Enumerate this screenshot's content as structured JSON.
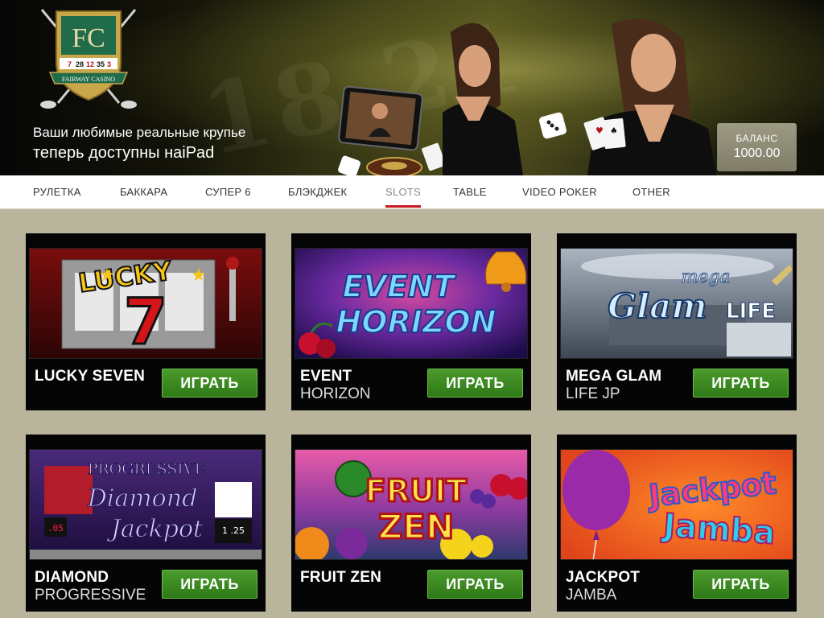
{
  "header": {
    "tagline_line1": "Ваши любимые реальные крупье",
    "tagline_line2": "теперь доступны наiPad",
    "logo_numbers": [
      "7",
      "28",
      "12",
      "35",
      "3"
    ],
    "logo_text": "FAIRWAY CASINO",
    "logo_monogram": "FC"
  },
  "balance": {
    "label": "БАЛАНС",
    "value": "1000.00"
  },
  "nav": {
    "items": [
      {
        "label": "РУЛЕТКА",
        "active": false
      },
      {
        "label": "БАККАРА",
        "active": false
      },
      {
        "label": "СУПЕР 6",
        "active": false
      },
      {
        "label": "БЛЭКДЖЕК",
        "active": false
      },
      {
        "label": "SLOTS",
        "active": true
      },
      {
        "label": "TABLE",
        "active": false
      },
      {
        "label": "VIDEO POKER",
        "active": false
      },
      {
        "label": "OTHER",
        "active": false
      }
    ]
  },
  "games": [
    {
      "title": "LUCKY SEVEN",
      "subtitle": "",
      "button": "ИГРАТЬ",
      "art_text": [
        "LUCKY",
        "7"
      ]
    },
    {
      "title": "EVENT",
      "subtitle": "HORIZON",
      "button": "ИГРАТЬ",
      "art_text": [
        "EVENT",
        "HORIZON"
      ]
    },
    {
      "title": "MEGA GLAM",
      "subtitle": "LIFE JP",
      "button": "ИГРАТЬ",
      "art_text": [
        "mega",
        "Glam",
        "LIFE"
      ]
    },
    {
      "title": "DIAMOND",
      "subtitle": "PROGRESSIVE",
      "button": "ИГРАТЬ",
      "art_text": [
        "PROGRESSIVE",
        "Diamond",
        "Jackpot"
      ]
    },
    {
      "title": "FRUIT ZEN",
      "subtitle": "",
      "button": "ИГРАТЬ",
      "art_text": [
        "FRUIT",
        "ZEN"
      ]
    },
    {
      "title": "JACKPOT",
      "subtitle": "JAMBA",
      "button": "ИГРАТЬ",
      "art_text": [
        "Jackpot",
        "Jamba"
      ]
    }
  ],
  "colors": {
    "nav_active_underline": "#c8191e",
    "play_button": "#3a8a22",
    "page_background": "#b9b49c"
  }
}
